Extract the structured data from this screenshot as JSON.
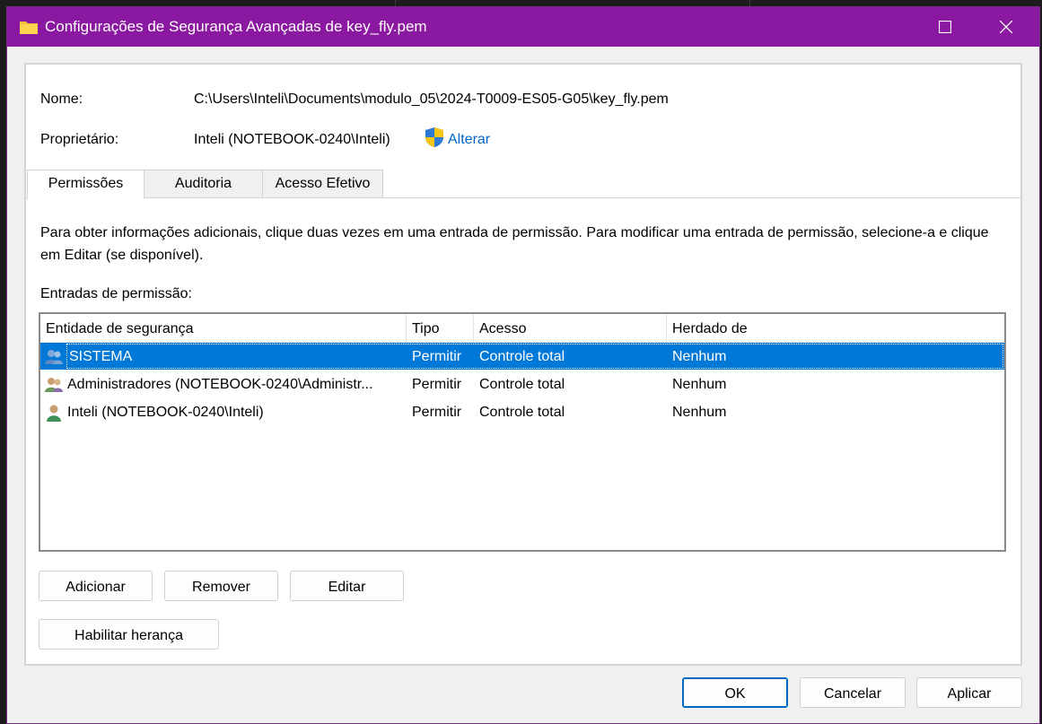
{
  "window": {
    "title": "Configurações de Segurança Avançadas de key_fly.pem"
  },
  "fields": {
    "name_label": "Nome:",
    "name_value": "C:\\Users\\Inteli\\Documents\\modulo_05\\2024-T0009-ES05-G05\\key_fly.pem",
    "owner_label": "Proprietário:",
    "owner_value": "Inteli (NOTEBOOK-0240\\Inteli)",
    "change_link": "Alterar"
  },
  "tabs": [
    {
      "label": "Permissões",
      "active": true
    },
    {
      "label": "Auditoria",
      "active": false
    },
    {
      "label": "Acesso Efetivo",
      "active": false
    }
  ],
  "description": "Para obter informações adicionais, clique duas vezes em uma entrada de permissão. Para modificar uma entrada de permissão, selecione-a e clique em Editar (se disponível).",
  "entries_label": "Entradas de permissão:",
  "table": {
    "columns": [
      "Entidade de segurança",
      "Tipo",
      "Acesso",
      "Herdado de"
    ],
    "rows": [
      {
        "icon": "group-users-icon",
        "principal": "SISTEMA",
        "type": "Permitir",
        "access": "Controle total",
        "inherited": "Nenhum",
        "selected": true
      },
      {
        "icon": "admin-group-icon",
        "principal": "Administradores (NOTEBOOK-0240\\Administr...",
        "type": "Permitir",
        "access": "Controle total",
        "inherited": "Nenhum",
        "selected": false
      },
      {
        "icon": "user-icon",
        "principal": "Inteli (NOTEBOOK-0240\\Inteli)",
        "type": "Permitir",
        "access": "Controle total",
        "inherited": "Nenhum",
        "selected": false
      }
    ]
  },
  "buttons": {
    "add": "Adicionar",
    "remove": "Remover",
    "edit": "Editar",
    "enable_inheritance": "Habilitar herança",
    "ok": "OK",
    "cancel": "Cancelar",
    "apply": "Aplicar"
  },
  "colors": {
    "titlebar": "#8b18a0",
    "selection": "#0078d7",
    "link": "#0066cc"
  }
}
